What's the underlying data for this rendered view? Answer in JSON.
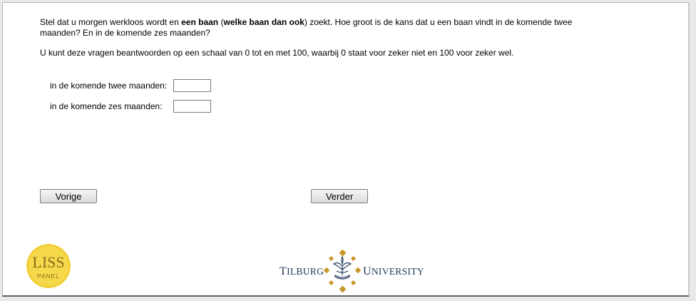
{
  "question": {
    "line1_prefix": "Stel dat u morgen werkloos wordt en ",
    "line1_bold1": "een baan",
    "line1_mid1": " (",
    "line1_bold2": "welke baan dan ook",
    "line1_suffix": ") zoekt. Hoe groot is de kans dat u een baan vindt in de komende twee maanden? En in de komende zes maanden?",
    "instruction": "U kunt deze vragen beantwoorden op een schaal van 0 tot en met 100, waarbij 0 staat voor zeker niet en 100 voor zeker wel."
  },
  "answers": [
    {
      "label": "in de komende twee maanden:",
      "value": ""
    },
    {
      "label": "in de komende zes maanden:",
      "value": ""
    }
  ],
  "nav": {
    "prev_label": "Vorige",
    "next_label": "Verder"
  },
  "logos": {
    "lis_top": "LISS",
    "lis_bottom": "PANEL",
    "tilburg_left_initial": "T",
    "tilburg_left_rest": "ILBURG",
    "tilburg_right_initial": "U",
    "tilburg_right_rest": "NIVERSITY"
  },
  "colors": {
    "lis_yellow": "#f6d94b",
    "lis_text": "#8a6a1c",
    "tilburg_blue": "#1f3a5a",
    "tilburg_gold": "#c8962a"
  }
}
